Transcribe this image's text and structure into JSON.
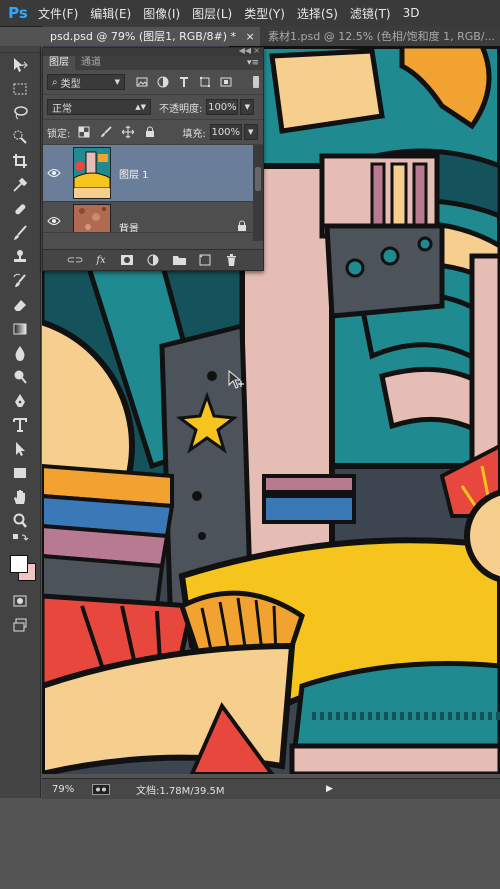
{
  "app": {
    "logo": "Ps"
  },
  "menu": [
    "文件(F)",
    "编辑(E)",
    "图像(I)",
    "图层(L)",
    "类型(Y)",
    "选择(S)",
    "滤镜(T)",
    "3D"
  ],
  "tabs": [
    {
      "label": "psd.psd @ 79% (图层1, RGB/8#) *",
      "close": "×",
      "active": true
    },
    {
      "label": "素材1.psd @ 12.5% (色相/饱和度 1, RGB/...",
      "active": false
    }
  ],
  "tools": [
    "move-tool-icon",
    "marquee-tool-icon",
    "lasso-tool-icon",
    "quick-select-icon",
    "crop-tool-icon",
    "eyedropper-icon",
    "healing-brush-icon",
    "brush-tool-icon",
    "clone-stamp-icon",
    "history-brush-icon",
    "eraser-icon",
    "gradient-tool-icon",
    "blur-tool-icon",
    "dodge-tool-icon",
    "pen-tool-icon",
    "type-tool-icon",
    "path-select-icon",
    "shape-tool-icon",
    "hand-tool-icon",
    "zoom-tool-icon"
  ],
  "swatches": {
    "foreground": "#ffffff",
    "background": "#f2c5c0"
  },
  "layers_panel": {
    "tabs": [
      "图层",
      "通道"
    ],
    "filter_kind": "类型",
    "blend_mode": "正常",
    "opacity_label": "不透明度:",
    "opacity_value": "100%",
    "lock_label": "锁定:",
    "fill_label": "填充:",
    "fill_value": "100%",
    "layers": [
      {
        "name": "图层 1",
        "selected": true
      },
      {
        "name": "背景",
        "selected": false,
        "locked": true
      }
    ],
    "footer_icons": [
      "link-icon",
      "fx-icon",
      "mask-icon",
      "adjustment-icon",
      "group-icon",
      "new-layer-icon",
      "delete-icon"
    ],
    "footer_fx": "fx"
  },
  "status": {
    "zoom": "79%",
    "doc_info": "文档:1.78M/39.5M",
    "arrow": "▶"
  },
  "colors": {
    "teal": "#1f8a90",
    "dark_teal": "#15535c",
    "pink": "#e6bdb5",
    "cream": "#f6cf8f",
    "yellow": "#f5c51d",
    "orange": "#f2a230",
    "red": "#e8473e",
    "blue": "#3a78b8",
    "gray": "#4d535b",
    "outline": "#111111",
    "mauve": "#b77a91"
  }
}
